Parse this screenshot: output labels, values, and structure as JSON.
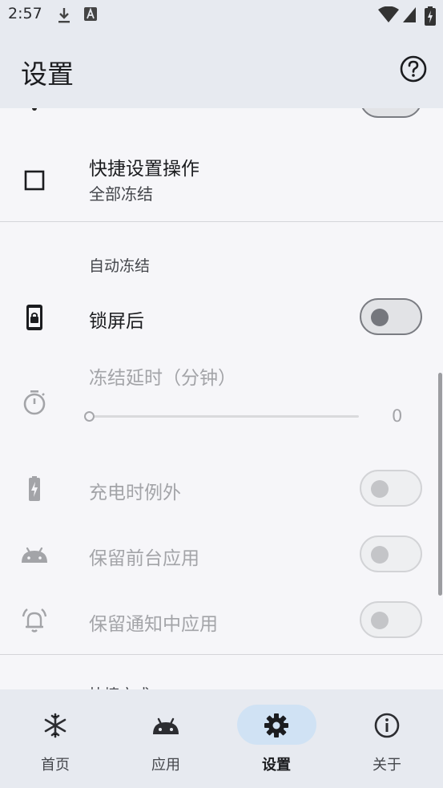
{
  "status_bar": {
    "time": "2:57"
  },
  "app_bar": {
    "title": "设置"
  },
  "settings": {
    "quick_action": {
      "label": "快捷设置操作",
      "value": "全部冻结"
    },
    "auto_freeze": {
      "header": "自动冻结",
      "after_lock": {
        "label": "锁屏后",
        "enabled": false
      },
      "freeze_delay": {
        "label": "冻结延时（分钟）",
        "value": "0",
        "level": 0
      },
      "except_charging": {
        "label": "充电时例外",
        "enabled": false
      },
      "keep_foreground": {
        "label": "保留前台应用",
        "enabled": false
      },
      "keep_notification": {
        "label": "保留通知中应用",
        "enabled": false
      }
    },
    "partial_next_header": "快捷方式"
  },
  "bottom_nav": {
    "items": [
      {
        "label": "首页",
        "icon": "snowflake-icon"
      },
      {
        "label": "应用",
        "icon": "android-icon"
      },
      {
        "label": "设置",
        "icon": "gear-icon",
        "active": true
      },
      {
        "label": "关于",
        "icon": "info-icon"
      }
    ]
  },
  "colors": {
    "accent_pill": "#d0e2f4",
    "bar_background": "#e7eaf0",
    "page_background": "#f6f6f9"
  }
}
